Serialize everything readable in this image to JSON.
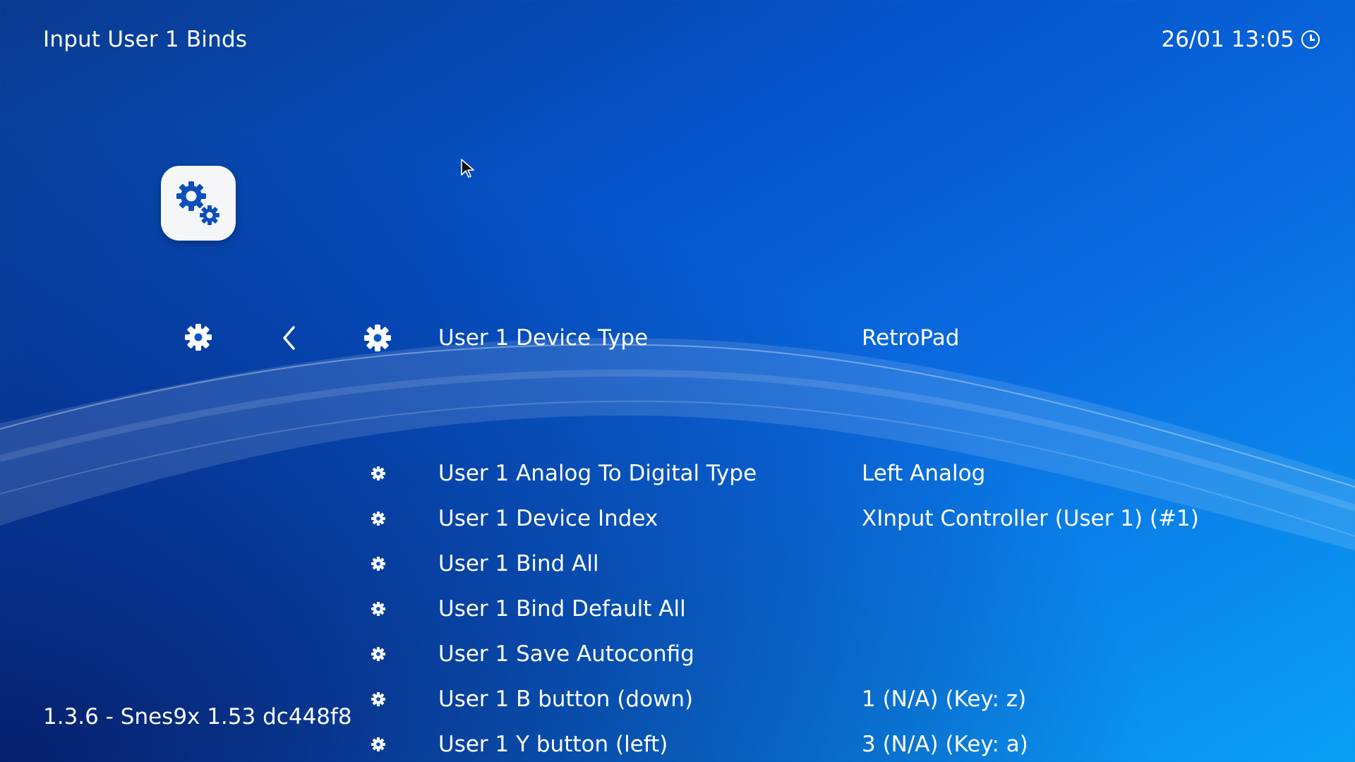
{
  "header": {
    "title": "Input User 1 Binds",
    "datetime": "26/01 13:05"
  },
  "icons": {
    "app": "settings-gears-icon",
    "nav_settings": "gear-icon",
    "nav_back": "chevron-left-icon",
    "cursor": "mouse-pointer-icon"
  },
  "menu": {
    "selected": {
      "label": "User 1 Device Type",
      "value": "RetroPad"
    },
    "items": [
      {
        "label": "User 1 Analog To Digital Type",
        "value": "Left Analog"
      },
      {
        "label": "User 1 Device Index",
        "value": "XInput Controller (User 1) (#1)"
      },
      {
        "label": "User 1 Bind All",
        "value": ""
      },
      {
        "label": "User 1 Bind Default All",
        "value": ""
      },
      {
        "label": "User 1 Save Autoconfig",
        "value": ""
      },
      {
        "label": "User 1 B button (down)",
        "value": "1 (N/A) (Key: z)"
      },
      {
        "label": "User 1 Y button (left)",
        "value": "3 (N/A) (Key: a)"
      }
    ]
  },
  "footer": {
    "version": "1.3.6 - Snes9x 1.53 dc448f8"
  },
  "colors": {
    "background_start": "#0a3a8f",
    "background_end": "#0aa0f5",
    "text": "#ffffff",
    "icon_tile": "#f5f6f8",
    "icon_tile_glyph": "#0b4fb8"
  }
}
